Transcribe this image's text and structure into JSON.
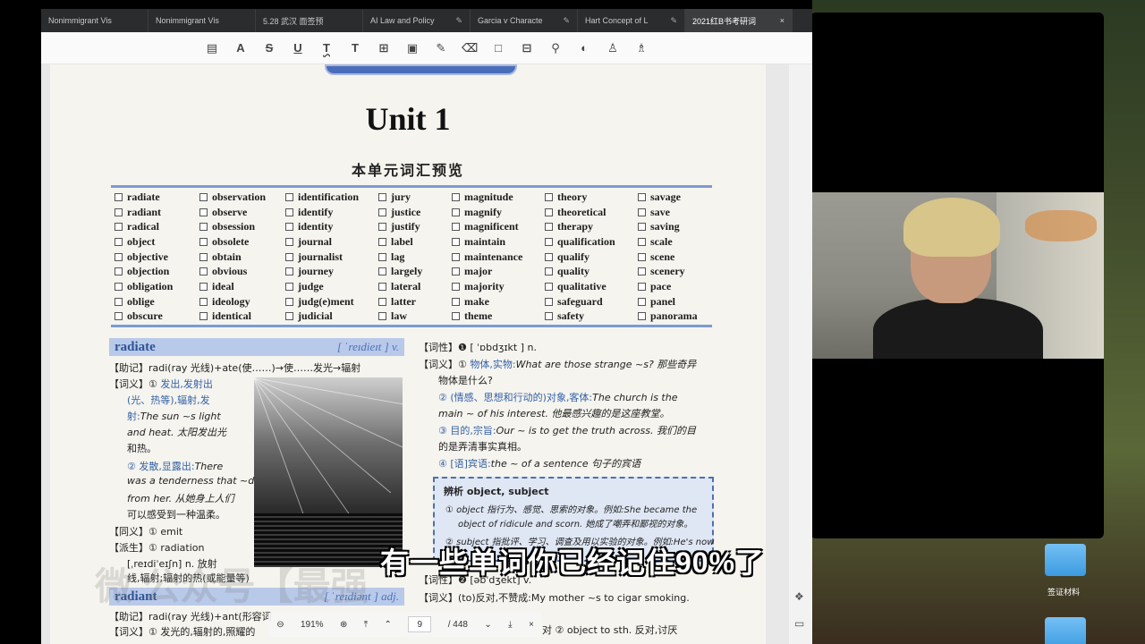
{
  "browser": {
    "tabs": [
      {
        "label": "Nonimmigrant Vis",
        "active": false
      },
      {
        "label": "Nonimmigrant Vis",
        "active": false
      },
      {
        "label": "5.28 武汉 面签预",
        "active": false
      },
      {
        "label": "AI Law and Policy",
        "active": false
      },
      {
        "label": "Garcia v Characte",
        "active": false
      },
      {
        "label": "Hart Concept of L",
        "active": false
      },
      {
        "label": "2021红B书考研词",
        "active": true
      }
    ]
  },
  "toolbar": {
    "icons": [
      "note-icon",
      "highlight-icon",
      "strikethrough-icon",
      "underline-icon",
      "squiggly-icon",
      "text-icon",
      "textbox-icon",
      "callout-icon",
      "pen-icon",
      "eraser-icon",
      "shape-icon",
      "measure-icon",
      "attach-icon",
      "color-icon",
      "stamp-icon",
      "sign-icon"
    ]
  },
  "page": {
    "unit_title": "Unit  1",
    "subtitle": "本单元词汇预览",
    "vocab_columns": [
      [
        "radiate",
        "radiant",
        "radical",
        "object",
        "objective",
        "objection",
        "obligation",
        "oblige",
        "obscure"
      ],
      [
        "observation",
        "observe",
        "obsession",
        "obsolete",
        "obtain",
        "obvious",
        "ideal",
        "ideology",
        "identical"
      ],
      [
        "identification",
        "identify",
        "identity",
        "journal",
        "journalist",
        "journey",
        "judge",
        "judg(e)ment",
        "judicial"
      ],
      [
        "jury",
        "justice",
        "justify",
        "label",
        "lag",
        "largely",
        "lateral",
        "latter",
        "law"
      ],
      [
        "magnitude",
        "magnify",
        "magnificent",
        "maintain",
        "maintenance",
        "major",
        "majority",
        "make",
        "theme"
      ],
      [
        "theory",
        "theoretical",
        "therapy",
        "qualification",
        "qualify",
        "quality",
        "qualitative",
        "safeguard",
        "safety"
      ],
      [
        "savage",
        "save",
        "saving",
        "scale",
        "scene",
        "scenery",
        "pace",
        "panel",
        "panorama"
      ]
    ],
    "entry1": {
      "word": "radiate",
      "pron": "[ ˈreɪdieɪt ]  v.",
      "mnemonic": "【助记】radi(ray 光线)+ate(使……)→使……发光→辐射",
      "def_label": "【词义】① ",
      "def1_a": "发出,发射出",
      "def1_b": "(光、热等),辐射,发",
      "def1_c": "射:",
      "ex1_a": "The  sun  ~s  light",
      "ex1_b": "and heat. 太阳发出光",
      "ex1_c": "和热。",
      "def2": "② 发散,显露出:",
      "ex2_a": "There",
      "ex2_b": "was a tenderness that  ~d",
      "ex2_c": "from her. 从她身上人们",
      "ex2_d": "可以感受到一种温柔。",
      "syn": "【同义】① emit",
      "der": "【派生】① radiation",
      "der_pron": "[ˌreɪdiˈeɪʃn]  n. 放射",
      "der_def": "线,辐射;辐射的热(或能量等)"
    },
    "entry2": {
      "word": "radiant",
      "pron": "[ ˈreɪdiənt ]  adj.",
      "mnemonic": "【助记】radi(ray 光线)+ant(形容词",
      "def": "【词义】① 发光的,辐射的,照耀的"
    },
    "object_entry": {
      "pos": "【词性】❶ [ ˈɒbdʒɪkt ]  n.",
      "def_label": "【词义】① ",
      "def1": "物体,实物:",
      "ex1": "What are those strange  ~s?  那些奇异",
      "ex1_b": "物体是什么?",
      "def2": "② (情感、思想和行动的)对象,客体:",
      "ex2": "The church is the",
      "ex2_b": "main  ~  of his interest.  他最感兴趣的是这座教堂。",
      "def3": "③ 目的,宗旨:",
      "ex3": "Our  ~  is to get the truth across. 我们的目",
      "ex3_b": "的是弄清事实真相。",
      "def4": "④ [语]宾语:",
      "ex4": "the  ~  of a sentence 句子的宾语",
      "analysis_title": "辨析   object, subject",
      "analysis1": "① object 指行为、感觉、思索的对象。例如:She became the",
      "analysis1_b": "object of ridicule and scorn. 她成了嘲弄和鄙视的对象。",
      "analysis2": "② subject 指批评、学习、调查及用以实验的对象。例如:He's now",
      "pos2": "【词性】❷ [əbˈdʒekt]  v.",
      "def_v": "【词义】(to)反对,不赞成:My mother  ~s to cigar smoking.",
      "def_v2": "对 ② object to sth. 反对,讨厌"
    },
    "watermark": "微  公众号【最强"
  },
  "pdf_controls": {
    "zoom": "191%",
    "current_page": "9",
    "total_pages": "/ 448"
  },
  "caption": "有一些单词你已经记住90%了",
  "desktop": {
    "folder_label": "签证材料"
  }
}
